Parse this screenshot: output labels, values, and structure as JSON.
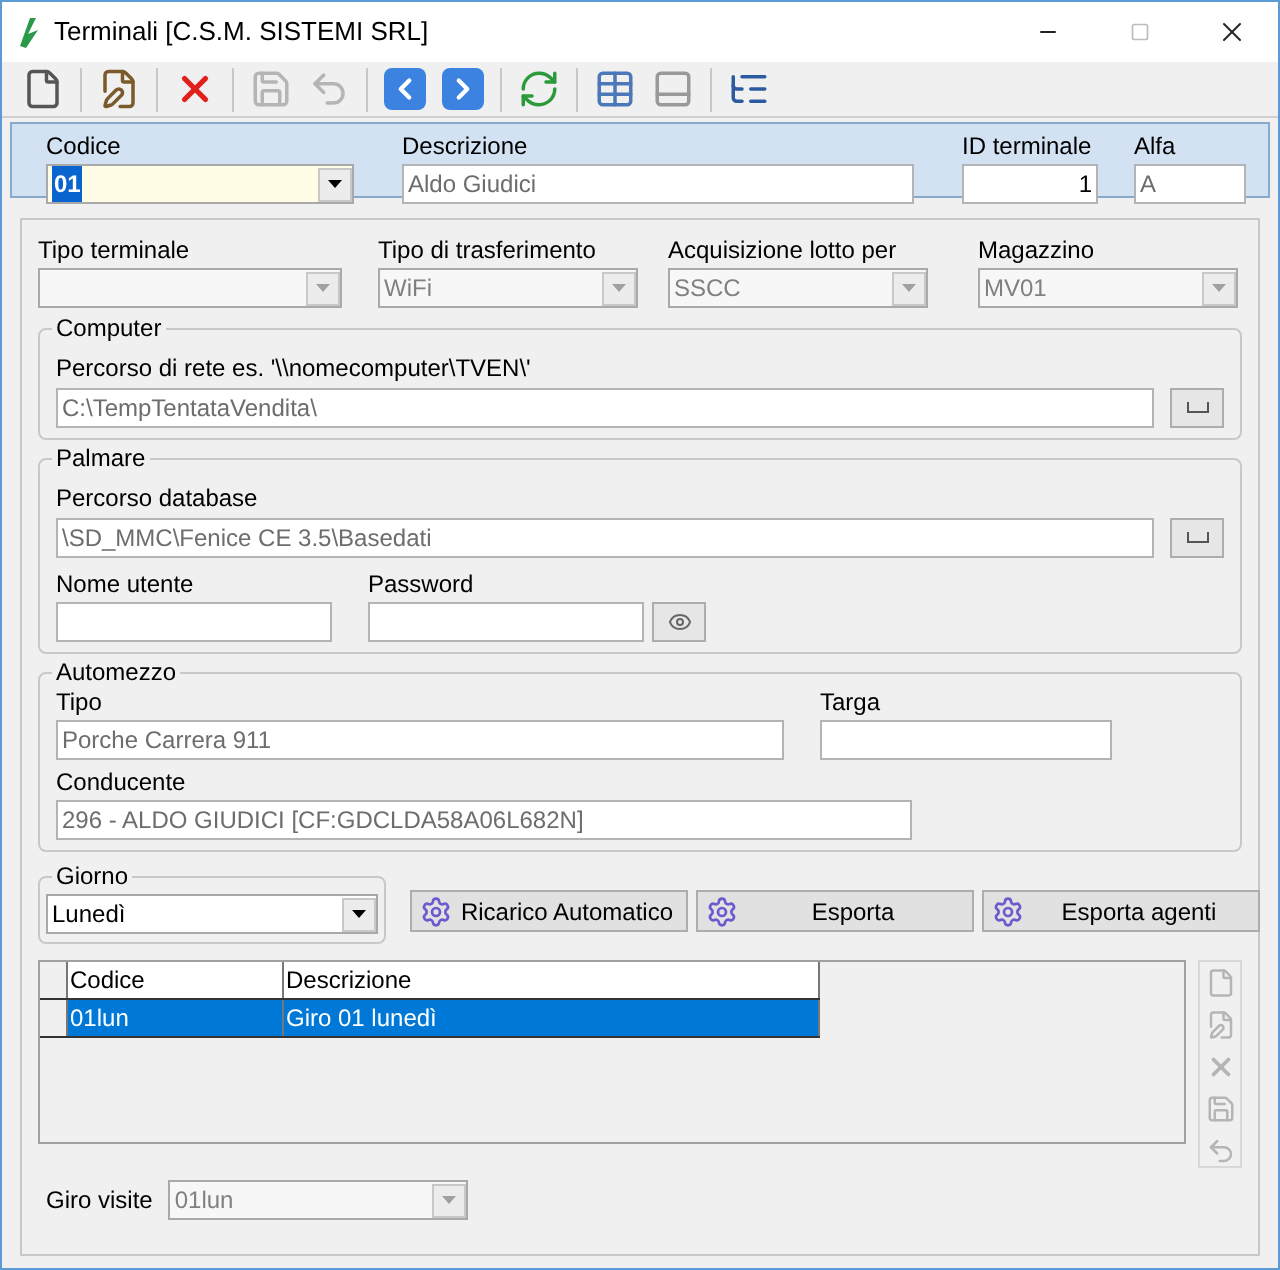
{
  "window": {
    "title": "Terminali [C.S.M. SISTEMI SRL]"
  },
  "toolbar": [
    {
      "kind": "new",
      "disabled": false
    },
    {
      "kind": "separator"
    },
    {
      "kind": "edit",
      "disabled": false
    },
    {
      "kind": "separator"
    },
    {
      "kind": "delete",
      "disabled": false
    },
    {
      "kind": "separator"
    },
    {
      "kind": "save",
      "disabled": true
    },
    {
      "kind": "undo",
      "disabled": true
    },
    {
      "kind": "separator"
    },
    {
      "kind": "prev",
      "disabled": false
    },
    {
      "kind": "next",
      "disabled": false
    },
    {
      "kind": "separator"
    },
    {
      "kind": "refresh",
      "disabled": false
    },
    {
      "kind": "separator"
    },
    {
      "kind": "grid",
      "disabled": false
    },
    {
      "kind": "form",
      "disabled": false
    },
    {
      "kind": "separator"
    },
    {
      "kind": "tree",
      "disabled": false
    }
  ],
  "header": {
    "codice": {
      "label": "Codice",
      "value": "01",
      "highlighted": true,
      "disabled": false
    },
    "descrizione": {
      "label": "Descrizione",
      "value": "Aldo Giudici"
    },
    "id_terminale": {
      "label": "ID terminale",
      "value": "1"
    },
    "alfa": {
      "label": "Alfa",
      "value": "A"
    }
  },
  "settings": [
    {
      "label": "Tipo terminale",
      "disabled": true
    },
    {
      "label": "Tipo di trasferimento",
      "value": "WiFi",
      "disabled": true
    },
    {
      "label": "Acquisizione lotto per",
      "value": "SSCC",
      "disabled": true
    },
    {
      "label": "Magazzino",
      "value": "MV01",
      "disabled": true
    }
  ],
  "computer": {
    "title": "Computer",
    "path": {
      "label": "Percorso di rete es. '\\\\nomecomputer\\TVEN\\'",
      "value": "C:\\TempTentataVendita\\"
    }
  },
  "palmare": {
    "title": "Palmare",
    "database": {
      "label": "Percorso database",
      "value": "\\SD_MMC\\Fenice CE 3.5\\Basedati"
    },
    "username": {
      "label": "Nome utente"
    },
    "password": {
      "label": "Password"
    }
  },
  "automezzo": {
    "title": "Automezzo",
    "tipo": {
      "label": "Tipo",
      "value": "Porche Carrera 911"
    },
    "targa": {
      "label": "Targa"
    },
    "conducente": {
      "label": "Conducente",
      "value": "296 - ALDO GIUDICI [CF:GDCLDA58A06L682N]"
    }
  },
  "giorno": {
    "title": "Giorno",
    "value": "Lunedì",
    "disabled": false
  },
  "buttons": [
    "Ricarico Automatico",
    "Esporta",
    "Esporta agenti"
  ],
  "table": {
    "columns": [
      "Codice",
      "Descrizione"
    ],
    "rows": [
      {
        "cells": [
          "01lun",
          "Giro 01 lunedì"
        ],
        "selected": true
      }
    ]
  },
  "side_toolbar": [
    {
      "kind": "new",
      "disabled": true
    },
    {
      "kind": "edit",
      "disabled": true
    },
    {
      "kind": "delete",
      "disabled": true
    },
    {
      "kind": "save",
      "disabled": true
    },
    {
      "kind": "undo",
      "disabled": true
    }
  ],
  "giro_visite": {
    "label": "Giro visite",
    "value": "01lun",
    "disabled": true
  }
}
